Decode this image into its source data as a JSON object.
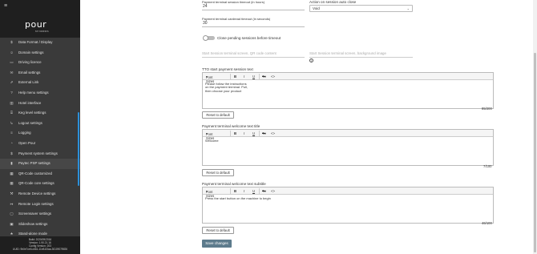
{
  "sidebar": {
    "menu_icon": "hamburger-icon",
    "logo": {
      "brand": "pour",
      "sub": "MY DRINKS"
    },
    "items": [
      {
        "label": "Data Format / Display",
        "icon": "$"
      },
      {
        "label": "Domain settings",
        "icon": "☺"
      },
      {
        "label": "Driving licence",
        "icon": "▭"
      },
      {
        "label": "Email settings",
        "icon": "✉"
      },
      {
        "label": "External Link",
        "icon": "⇗"
      },
      {
        "label": "Help menu settings",
        "icon": "?"
      },
      {
        "label": "Hotel interface",
        "icon": "▥"
      },
      {
        "label": "Keg level settings",
        "icon": "⌹"
      },
      {
        "label": "Logout settings",
        "icon": "↳"
      },
      {
        "label": "Logging",
        "icon": "≡"
      },
      {
        "label": "Open Pour",
        "icon": "◔"
      },
      {
        "label": "Payment system settings",
        "icon": "$"
      },
      {
        "label": "Paytec PSP settings",
        "icon": "▮"
      },
      {
        "label": "QR-Code customized",
        "icon": "▦"
      },
      {
        "label": "QR-Code core settings",
        "icon": "▦"
      },
      {
        "label": "Remote Device settings",
        "icon": "⚒"
      },
      {
        "label": "Remote Login settings",
        "icon": "↦"
      },
      {
        "label": "Screensaver settings",
        "icon": "▢"
      },
      {
        "label": "Slideshow settings",
        "icon": "▣"
      },
      {
        "label": "Stand-alone mode",
        "icon": "★"
      }
    ],
    "build_info": [
      "Build: 2020/09/2016",
      "Version: 1.90.21.16",
      "Config Version: 203",
      "UUID: 9b0e7ce6-c661-11e8-83aa-3010907f5f26"
    ]
  },
  "form": {
    "timeout_label": "Payment terminal session timeout (in hours)",
    "timeout_value": "24",
    "action_label": "Action on session auto close",
    "action_value": "Void",
    "cardread_label": "Payment terminal cardread timeout (in seconds)",
    "cardread_value": "30",
    "close_pending_label": "Close pending sessions before timeout",
    "start_screen_placeholder": "Start Session terminal screen, QR code content",
    "start_screen_bg_placeholder": "Start Session terminal screen, background image",
    "editors": [
      {
        "label": "TTO start payment session text",
        "toolbar": {
          "font_sizes": "Font Sizes",
          "bold": "B",
          "italic": "I",
          "underline": "U",
          "clear": "Tx",
          "code": "<>"
        },
        "lines": [
          "Please follow the instructions",
          "on the payment terminal. Pull,",
          "then choose your product"
        ],
        "counter": "85/200",
        "reset_label": "Reset to default"
      },
      {
        "label": "Payment terminal welcome text title",
        "toolbar": {
          "font_sizes": "Font Sizes",
          "bold": "B",
          "italic": "I",
          "underline": "U",
          "clear": "Tx",
          "code": "<>"
        },
        "lines": [
          "Welcome"
        ],
        "counter": "7/100",
        "reset_label": "Reset to default"
      },
      {
        "label": "Payment terminal welcome text subtitle",
        "toolbar": {
          "font_sizes": "Font Sizes",
          "bold": "B",
          "italic": "I",
          "underline": "U",
          "clear": "Tx",
          "code": "<>"
        },
        "lines": [
          "Press the start button on the machine to begin"
        ],
        "counter": "46/100",
        "reset_label": "Reset to default"
      }
    ],
    "save_label": "Save changes"
  }
}
